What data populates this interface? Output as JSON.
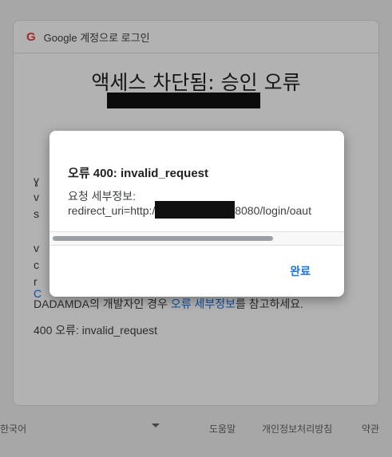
{
  "header": {
    "logo_letter": "G",
    "text": "Google 계정으로 로그인"
  },
  "main": {
    "title": "액세스 차단됨: 승인 오류",
    "developer_line_prefix": "DADAMDA의 개발자인 경우 ",
    "developer_line_link": "오류 세부정보",
    "developer_line_suffix": "를 참고하세요.",
    "error_line": "400 오류: invalid_request",
    "frag_1": "ɣ",
    "frag_2": "v",
    "frag_3": "s",
    "frag_4": "v",
    "frag_5": "c",
    "frag_6": "r",
    "frag_7": "C"
  },
  "dialog": {
    "title": "오류 400: invalid_request",
    "detail_label": "요청 세부정보:",
    "uri_prefix": "redirect_uri=http://",
    "uri_suffix": "8080/login/oaut",
    "ok_label": "완료",
    "scroll_fraction": 0.75
  },
  "footer": {
    "language": "한국어",
    "help": "도움말",
    "privacy": "개인정보처리방침",
    "terms": "약관"
  },
  "colors": {
    "link": "#1a73e8",
    "google_red": "#ea4335"
  }
}
